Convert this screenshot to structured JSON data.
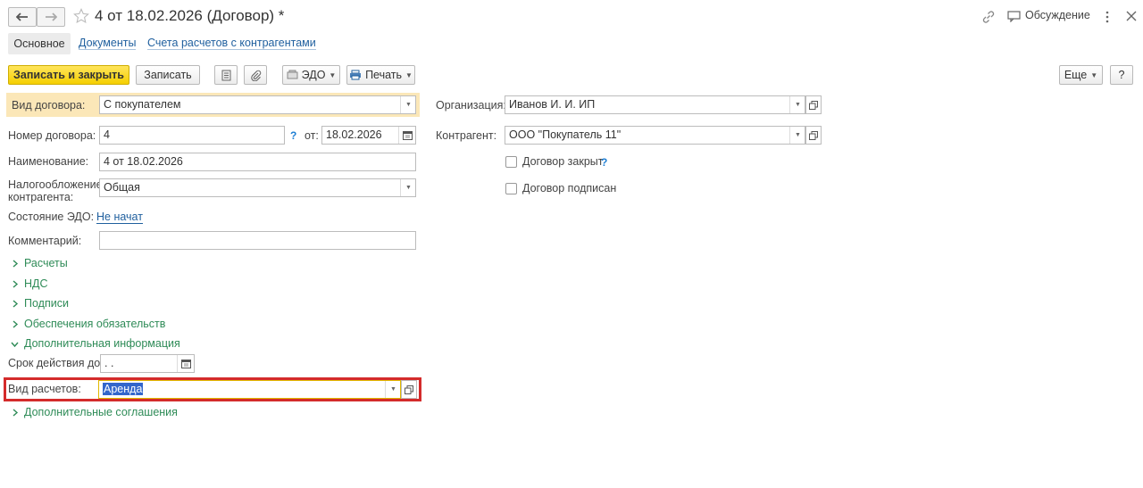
{
  "header": {
    "title": "4 от 18.02.2026 (Договор) *",
    "discussion_label": "Обсуждение"
  },
  "tabs": [
    {
      "label": "Основное",
      "active": true
    },
    {
      "label": "Документы",
      "active": false
    },
    {
      "label": "Счета расчетов с контрагентами",
      "active": false
    }
  ],
  "toolbar": {
    "save_close_label": "Записать и закрыть",
    "save_label": "Записать",
    "edo_label": "ЭДО",
    "print_label": "Печать",
    "more_label": "Еще",
    "help_label": "?"
  },
  "form": {
    "contract_type_label": "Вид договора:",
    "contract_type_value": "С покупателем",
    "contract_number_label": "Номер договора:",
    "contract_number_value": "4",
    "date_from_label": "от:",
    "date_value": "18.02.2026",
    "name_label": "Наименование:",
    "name_value": "4 от 18.02.2026",
    "taxation_label_1": "Налогообложение",
    "taxation_label_2": "контрагента:",
    "taxation_value": "Общая",
    "edo_status_label": "Состояние ЭДО:",
    "edo_status_value": "Не начат",
    "comment_label": "Комментарий:",
    "comment_value": "",
    "organization_label": "Организация:",
    "organization_value": "Иванов И. И. ИП",
    "counterparty_label": "Контрагент:",
    "counterparty_value": "ООО \"Покупатель 11\"",
    "contract_closed_label": "Договор закрыт",
    "contract_signed_label": "Договор подписан",
    "valid_until_label": "Срок действия до:",
    "valid_until_value": " .  .",
    "settlement_type_label": "Вид расчетов:",
    "settlement_type_value": "Аренда",
    "help_mark": "?"
  },
  "sections": {
    "payments": "Расчеты",
    "vat": "НДС",
    "signatures": "Подписи",
    "obligations": "Обеспечения обязательств",
    "additional_info": "Дополнительная информация",
    "additional_agreements": "Дополнительные соглашения"
  },
  "colors": {
    "primary_button": "#f5cf00",
    "link": "#1f5f9e",
    "section": "#2e8b57",
    "highlight_row": "#fbe7b8",
    "annotation_box": "#d42b2b",
    "selection": "#3366cc"
  }
}
